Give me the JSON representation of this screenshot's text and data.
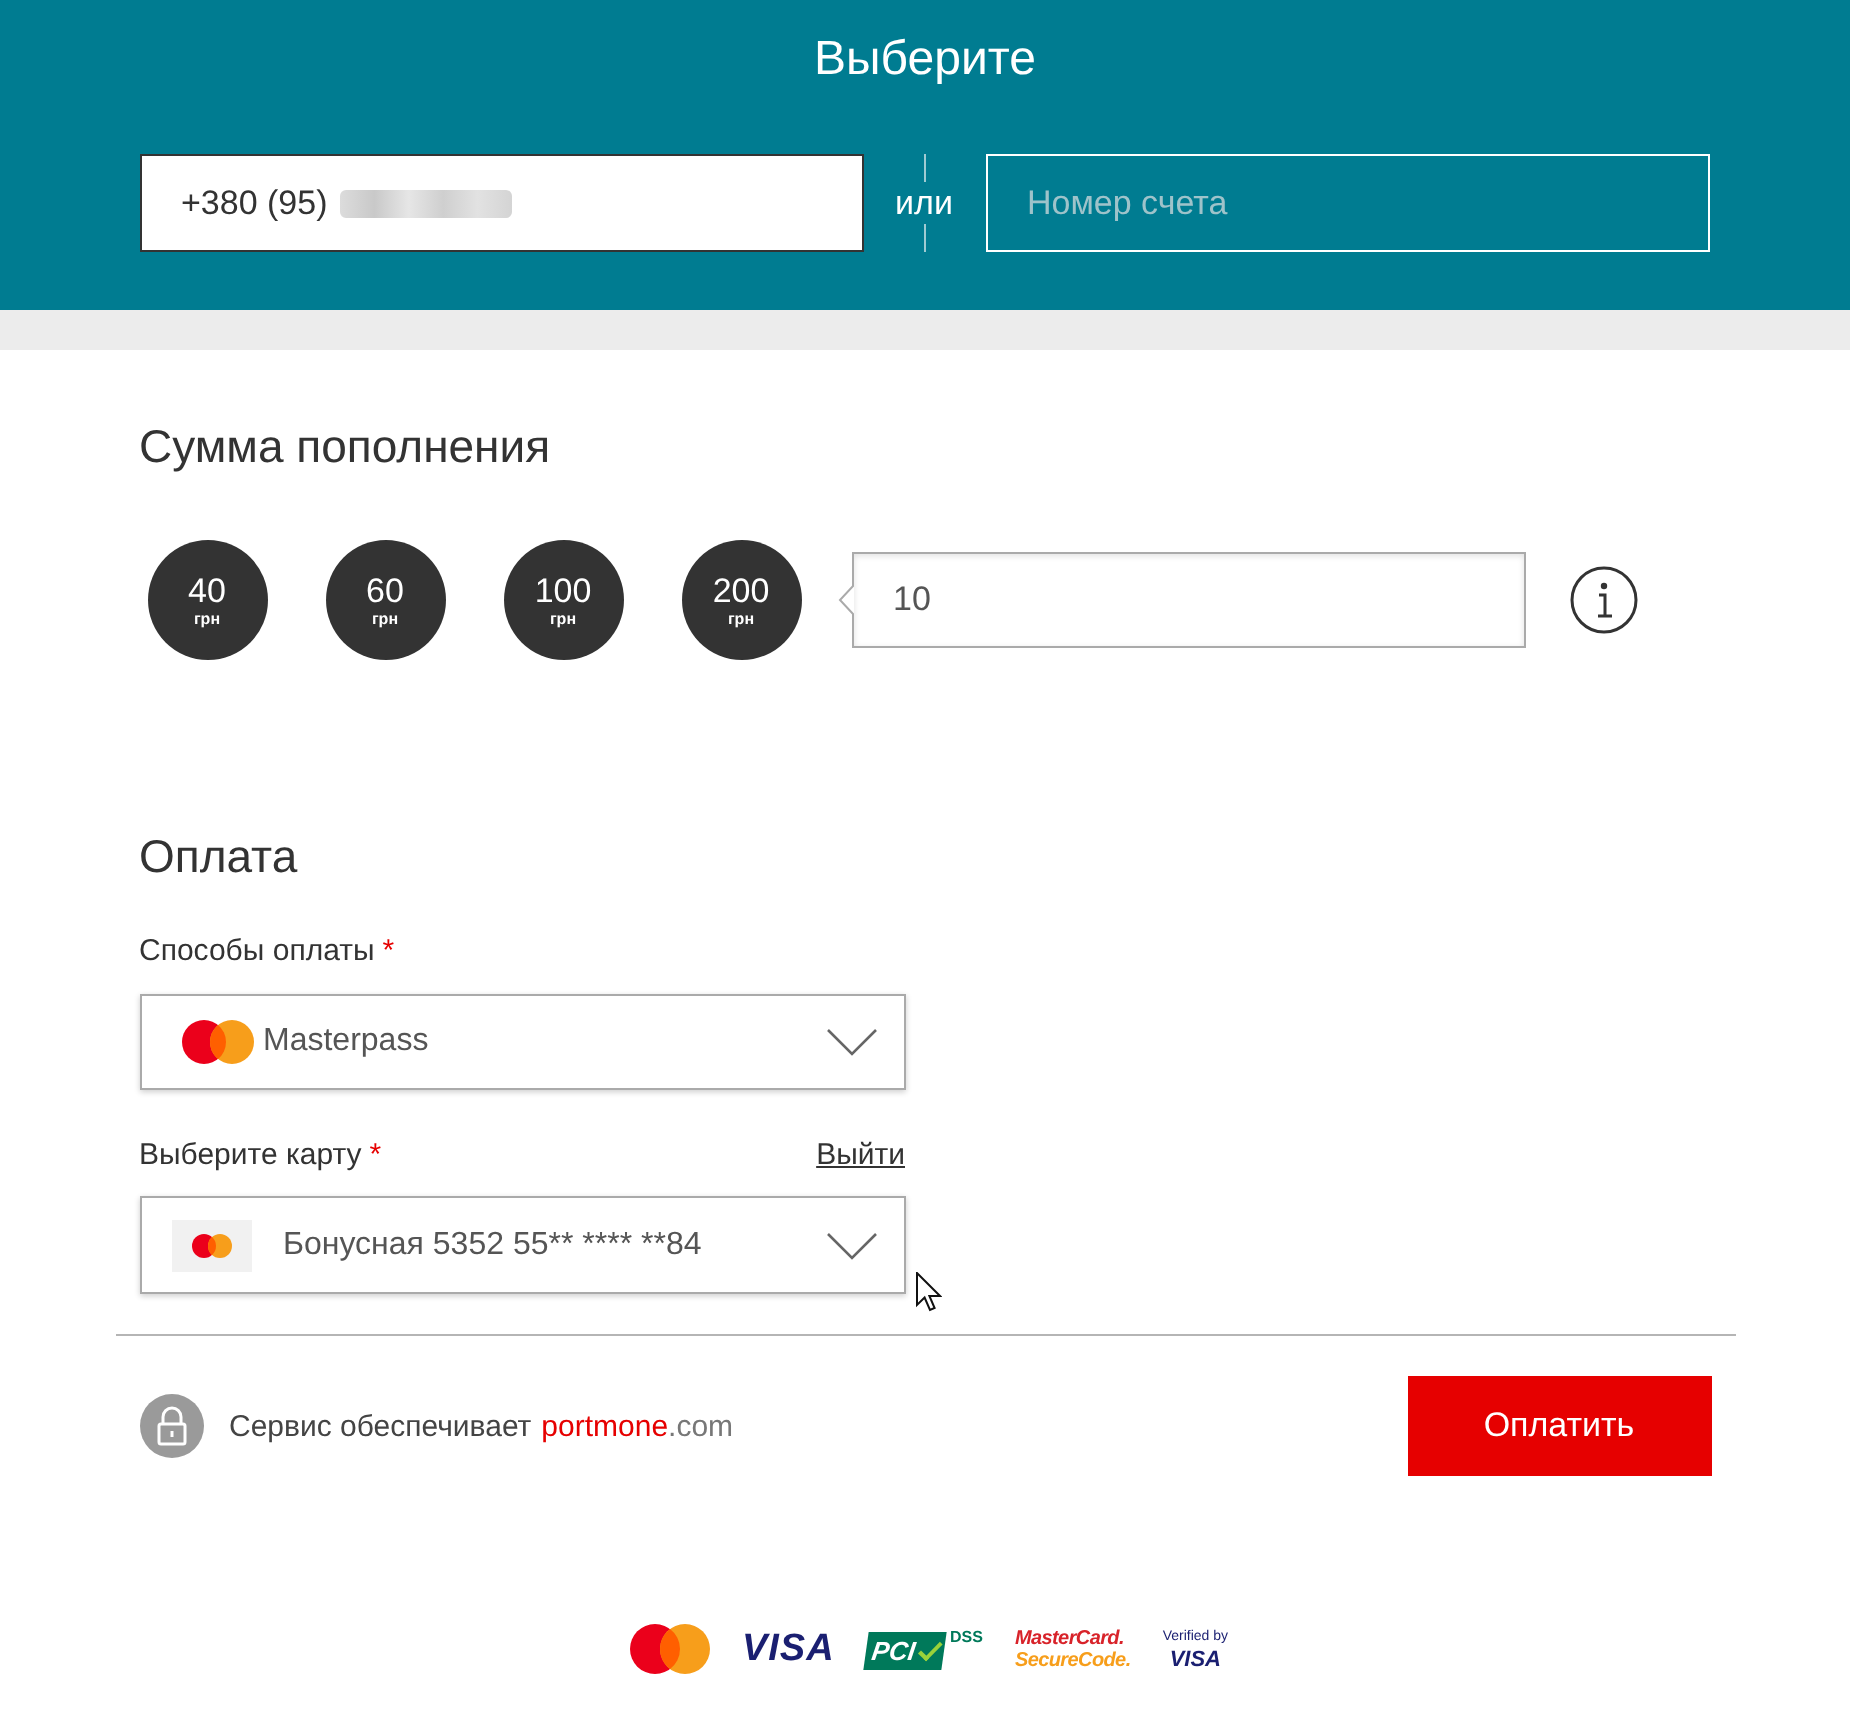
{
  "header": {
    "title": "Выберите",
    "phone_field": {
      "value": "+380 (95)",
      "redacted": true
    },
    "separator": "или",
    "account_field": {
      "placeholder": "Номер счета"
    }
  },
  "amount": {
    "title": "Сумма пополнения",
    "presets": [
      {
        "value": "40",
        "unit": "грн",
        "selected": false
      },
      {
        "value": "60",
        "unit": "грн",
        "selected": false
      },
      {
        "value": "100",
        "unit": "грн",
        "selected": false
      },
      {
        "value": "200",
        "unit": "грн",
        "selected": false
      }
    ],
    "amount_field": {
      "value": "10"
    }
  },
  "payment": {
    "title": "Оплата",
    "fields": [
      {
        "kind": "method",
        "label": "Способы оплаты",
        "required_mark": "*",
        "value": "Masterpass"
      },
      {
        "kind": "card",
        "label": "Выберите карту",
        "required_mark": "*",
        "link": "Выйти",
        "value": "Бонусная 5352 55** **** **84"
      }
    ]
  },
  "footer": {
    "service_text": "Сервис обеспечивает",
    "brand": "portmone",
    "brand_suffix": ".com",
    "pay_button": "Оплатить"
  },
  "badges": [
    {
      "kind": "mastercard"
    },
    {
      "kind": "visa",
      "lines": [
        "VISA"
      ]
    },
    {
      "kind": "pci",
      "lines": [
        "PCI",
        "DSS"
      ]
    },
    {
      "kind": "securecode",
      "lines": [
        "MasterCard.",
        "SecureCode."
      ]
    },
    {
      "kind": "verified",
      "lines": [
        "Verified by",
        "VISA"
      ]
    }
  ]
}
